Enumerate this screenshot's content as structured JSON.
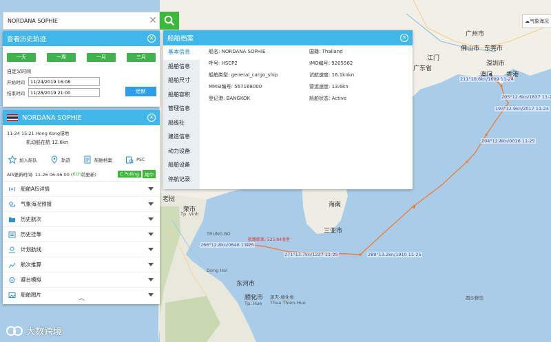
{
  "search": {
    "value": "NORDANA SOPHIE"
  },
  "history": {
    "title": "查看历史轨迹",
    "ranges": [
      "一天",
      "一周",
      "一月",
      "三月"
    ],
    "custom_label": "自定义时间",
    "start_label": "开始时间",
    "start_value": "11/24/2019 16:08",
    "end_label": "结束时间",
    "end_value": "11/28/2019 21:00",
    "draw_label": "绘制"
  },
  "ship": {
    "name": "NORDANA SOPHIE",
    "info_line1": "11-24 15:21 Hong Kong锚地",
    "info_line2": "机动船在航 12.6kn",
    "actions": [
      "加入船队",
      "轨迹",
      "船舶档案",
      "PSC"
    ],
    "ais_label": "AIS更新时间: 11-26 06:46:00 (",
    "ais_highlight": "61h",
    "ais_suffix": "前更新)",
    "badge1": "C Polling",
    "badge2": "尾中",
    "menu": [
      "船舶AIS详情",
      "气象海况预报",
      "历史航次",
      "历史挂靠",
      "计划航线",
      "航次推算",
      "避台模拟",
      "船舶图片"
    ]
  },
  "archive": {
    "title": "船舶档案",
    "tabs": [
      "基本信息",
      "船舶信息",
      "船舶尺寸",
      "船舶容积",
      "管理信息",
      "船级社",
      "建造信息",
      "动力设备",
      "船舶设备",
      "停航记录"
    ],
    "fields": [
      "船名: NORDANA SOPHIE",
      "国籍: Thailand",
      "呼号: HSCP2",
      "IMO编号: 9205562",
      "船舶类型: general_cargo_ship",
      "试航速度: 16.1knkn",
      "MMSI编号: 567168000",
      "营运速度: 13.6kn",
      "登记港: BANGKOK",
      "船舶状态: Active"
    ]
  },
  "weather": {
    "label": "气象海况"
  },
  "logo": {
    "text": "大数跨境"
  },
  "map": {
    "cities": [
      "广州市",
      "佛山市",
      "东莞市",
      "深圳市",
      "澳门",
      "香港",
      "广东省",
      "江门",
      "荣市",
      "Tp. Vinh",
      "海南",
      "三亚市",
      "东河市",
      "顺化市",
      "Tp. Hue",
      "承天-顺化省",
      "Thua Thien-Hue",
      "西沙群岛",
      "老挝",
      "TRUNG BO",
      "Dong Hoi"
    ],
    "track_labels": [
      "211°10.6kn/1609 11-24",
      "205°12.6kn/1837 11-24",
      "193°12.9kn/2017 11-24",
      "204°12.8kn/0016 11-25",
      "航路距离: 525.84海里",
      "266°12.8kn/0846 11-25",
      "271°13.7kn/1237 11-25",
      "289°13.2kn/1910 11-25"
    ]
  }
}
